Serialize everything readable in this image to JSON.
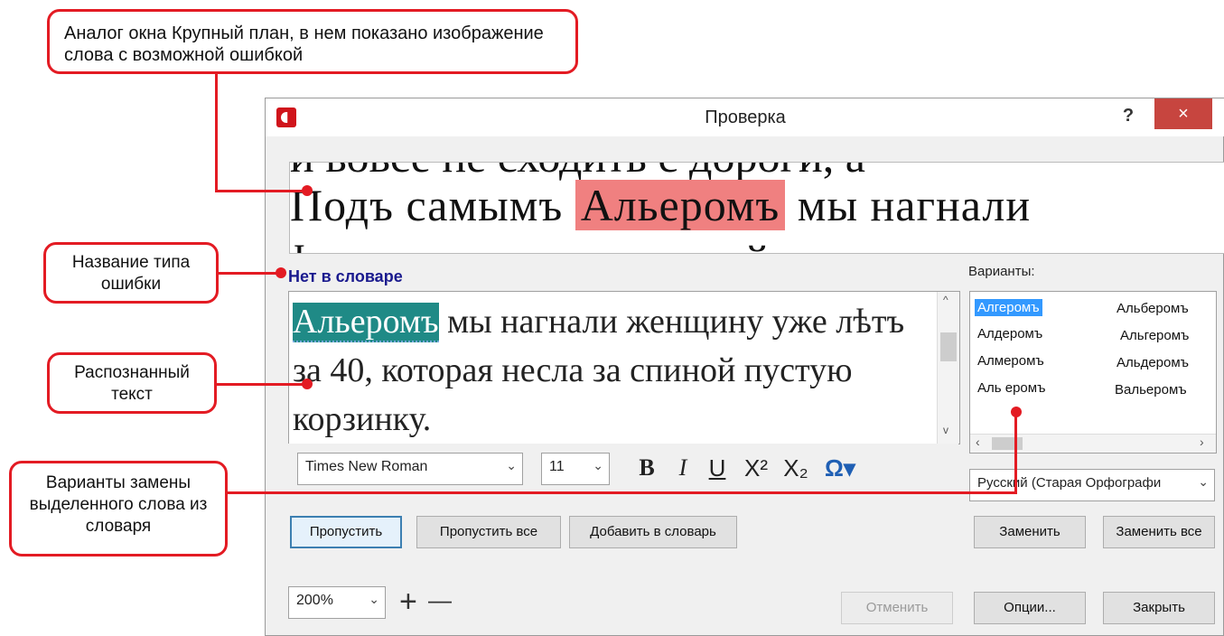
{
  "dialog": {
    "title": "Проверка",
    "help": "?",
    "close": "×"
  },
  "closeup": {
    "line_top": "и вовсе не сходить с дороги, а ",
    "before": "Подъ  самымъ ",
    "highlight": "Альеромъ",
    "after": " мы  нагнали  ",
    "line_bottom": "ѣ  посредствомъ  длинной  веревки,  за"
  },
  "error_type": "Нет в словаре",
  "recognized": {
    "highlight": "Альеромъ",
    "rest": " мы нагнали женщину уже лѣтъ за 40, которая несла за спиной пустую корзинку."
  },
  "format": {
    "font": "Times New Roman",
    "size": "11",
    "bold": "B",
    "italic": "I",
    "underline": "U",
    "superscript": "X²",
    "subscript": "X₂",
    "symbol": "Ω▾"
  },
  "variants": {
    "label": "Варианты:",
    "items": [
      "Алгеромъ",
      "Алдеромъ",
      "Алмеромъ",
      "Аль еромъ",
      "Альберомъ",
      "Альгеромъ",
      "Альдеромъ",
      "Вальеромъ"
    ]
  },
  "language": "Русский (Старая Орфографи",
  "buttons": {
    "skip": "Пропустить",
    "skip_all": "Пропустить все",
    "add_dict": "Добавить в словарь",
    "replace": "Заменить",
    "replace_all": "Заменить все",
    "undo": "Отменить",
    "options": "Опции...",
    "close": "Закрыть"
  },
  "zoom": {
    "value": "200%",
    "plus": "+",
    "minus": "—"
  },
  "callouts": {
    "closeup": "Аналог окна Крупный план, в нем показано изображение слова с возможной ошибкой",
    "error_type": "Название типа ошибки",
    "recognized": "Распознанный текст",
    "variants": "Варианты замены выделенного слова из словаря"
  },
  "colors": {
    "callout_red": "#e31b23",
    "highlight_image": "#f08080",
    "highlight_text": "#1f8a86",
    "selected_variant": "#3399ff"
  }
}
